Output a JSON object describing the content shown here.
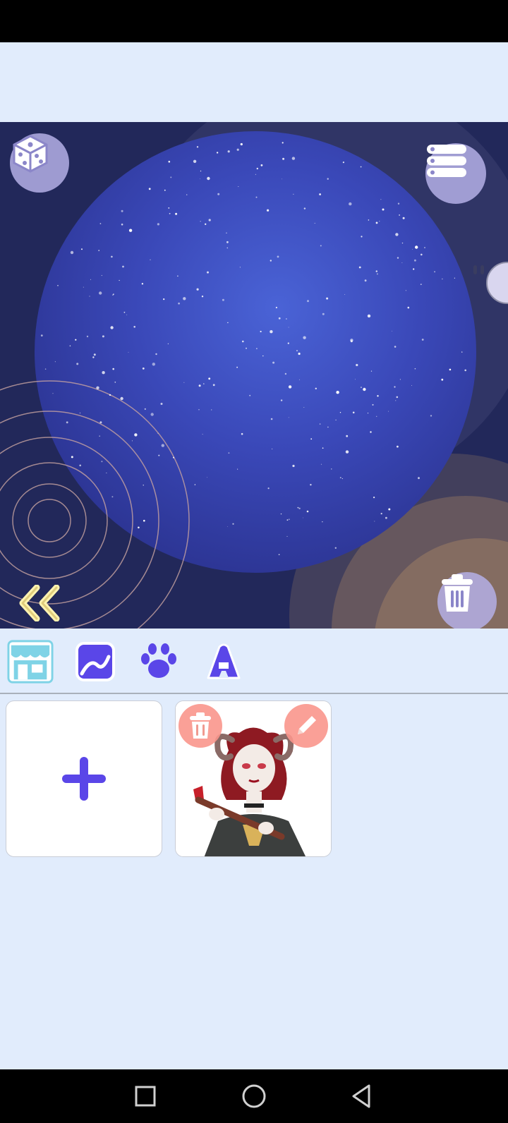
{
  "canvas": {
    "background": "starry-night-sky",
    "colors": {
      "deep": "#22285a",
      "galaxy": "#3a48b8",
      "accent_btn": "#b4afe6",
      "arrow": "#fff3b0"
    }
  },
  "buttons": {
    "randomize": {
      "icon": "dice-icon"
    },
    "menu": {
      "icon": "list-icon"
    },
    "toggle": {
      "icon": "pause-icon"
    },
    "delete_all": {
      "icon": "trash-icon"
    },
    "back": {
      "icon": "double-chevron-left-icon"
    }
  },
  "tabs": [
    {
      "icon": "shop-icon",
      "selected": true
    },
    {
      "icon": "background-icon",
      "selected": false
    },
    {
      "icon": "paw-icon",
      "selected": false
    },
    {
      "icon": "text-icon",
      "selected": false
    }
  ],
  "gallery": {
    "add_card": {
      "icon": "plus-icon"
    },
    "items": [
      {
        "thumbnail": "horned-character-with-axe",
        "delete_icon": "trash-icon",
        "edit_icon": "pencil-icon"
      }
    ]
  },
  "nav": {
    "recents": "square-icon",
    "home": "circle-icon",
    "back": "triangle-back-icon"
  }
}
